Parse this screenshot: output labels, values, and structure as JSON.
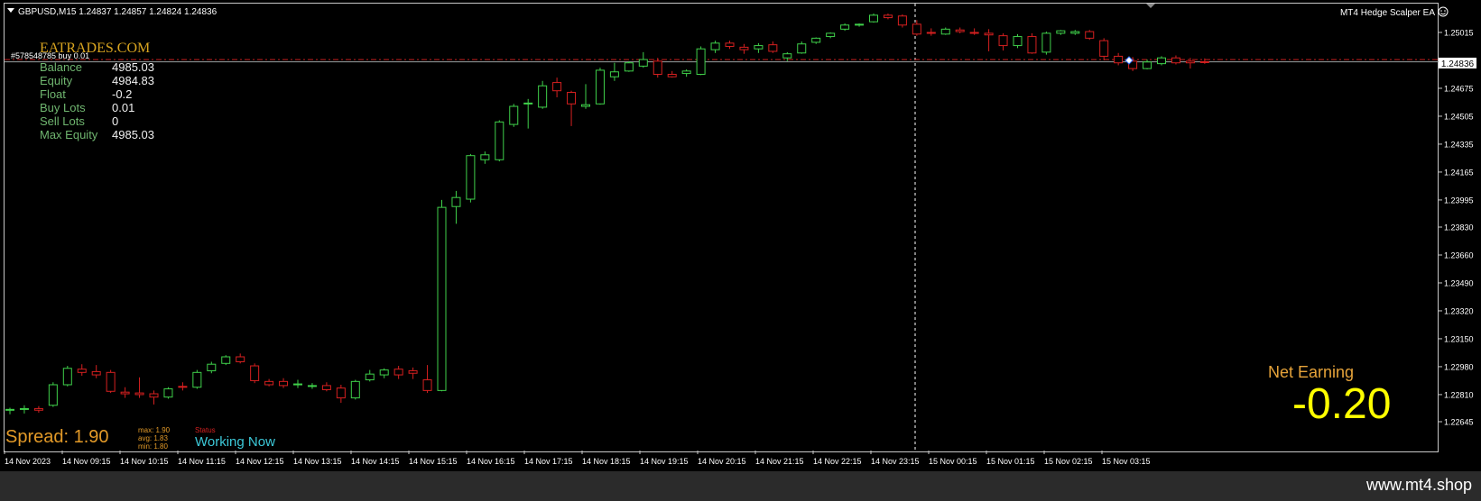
{
  "window": {
    "header_text": "GBPUSD,M15  1.24837 1.24857 1.24824 1.24836",
    "ea_name": "MT4 Hedge Scalper EA",
    "ea_status_icon": "smiley-icon"
  },
  "overlay": {
    "brand": "EATRADES.COM",
    "order_label": "#578548785 buy 0.01",
    "stats": [
      {
        "label": "Balance",
        "value": "4985.03"
      },
      {
        "label": "Equity",
        "value": "4984.83"
      },
      {
        "label": "Float",
        "value": "-0.2"
      },
      {
        "label": "Buy Lots",
        "value": "0.01"
      },
      {
        "label": "Sell Lots",
        "value": "0"
      },
      {
        "label": "Max Equity",
        "value": "4985.03"
      }
    ],
    "spread_text": "Spread: 1.90",
    "spread_max": "max: 1.90",
    "spread_avg": "avg: 1.83",
    "spread_min": "min: 1.80",
    "status_label": "Status",
    "status_text": "Working Now",
    "net_earning_label": "Net Earning",
    "net_earning_value": "-0.20"
  },
  "footer": {
    "site": "www.mt4.shop"
  },
  "colors": {
    "bull": "#3fd04a",
    "bear": "#d62020",
    "grid_text": "#ffffff",
    "bid_line": "#9aa0a0",
    "order_line": "#c81e1e",
    "brand": "#d9a520",
    "net_label": "#e6a33a",
    "net_value": "#ffff00",
    "status": "#3cc8d8",
    "spread": "#e39a28"
  },
  "chart_data": {
    "type": "candlestick",
    "symbol": "GBPUSD",
    "timeframe": "M15",
    "current_price": "1.24836",
    "ylim": [
      1.2249,
      1.2527
    ],
    "price_ticks": [
      "1.25015",
      "1.24836",
      "1.24675",
      "1.24505",
      "1.24335",
      "1.24165",
      "1.23995",
      "1.23830",
      "1.23660",
      "1.23490",
      "1.23320",
      "1.23150",
      "1.22980",
      "1.22810",
      "1.22645"
    ],
    "time_labels": [
      "14 Nov 2023",
      "14 Nov 09:15",
      "14 Nov 10:15",
      "14 Nov 11:15",
      "14 Nov 12:15",
      "14 Nov 13:15",
      "14 Nov 14:15",
      "14 Nov 15:15",
      "14 Nov 16:15",
      "14 Nov 17:15",
      "14 Nov 18:15",
      "14 Nov 19:15",
      "14 Nov 20:15",
      "14 Nov 21:15",
      "14 Nov 22:15",
      "14 Nov 23:15",
      "15 Nov 00:15",
      "15 Nov 01:15",
      "15 Nov 02:15",
      "15 Nov 03:15"
    ],
    "candles": [
      {
        "o": 1.22715,
        "h": 1.2273,
        "l": 1.2269,
        "c": 1.2272
      },
      {
        "o": 1.2272,
        "h": 1.22745,
        "l": 1.22695,
        "c": 1.22725
      },
      {
        "o": 1.22725,
        "h": 1.2274,
        "l": 1.227,
        "c": 1.22715
      },
      {
        "o": 1.22745,
        "h": 1.22885,
        "l": 1.22735,
        "c": 1.2287
      },
      {
        "o": 1.2287,
        "h": 1.22985,
        "l": 1.2286,
        "c": 1.2297
      },
      {
        "o": 1.22965,
        "h": 1.22995,
        "l": 1.22925,
        "c": 1.22945
      },
      {
        "o": 1.2295,
        "h": 1.2299,
        "l": 1.2291,
        "c": 1.2293
      },
      {
        "o": 1.22945,
        "h": 1.2296,
        "l": 1.2282,
        "c": 1.2283
      },
      {
        "o": 1.22825,
        "h": 1.22855,
        "l": 1.2279,
        "c": 1.22815
      },
      {
        "o": 1.2282,
        "h": 1.22915,
        "l": 1.2279,
        "c": 1.2281
      },
      {
        "o": 1.22815,
        "h": 1.22835,
        "l": 1.2275,
        "c": 1.22795
      },
      {
        "o": 1.22795,
        "h": 1.22855,
        "l": 1.22785,
        "c": 1.22845
      },
      {
        "o": 1.2286,
        "h": 1.22885,
        "l": 1.22835,
        "c": 1.22855
      },
      {
        "o": 1.22855,
        "h": 1.2296,
        "l": 1.22845,
        "c": 1.22945
      },
      {
        "o": 1.22955,
        "h": 1.2301,
        "l": 1.2294,
        "c": 1.22995
      },
      {
        "o": 1.23,
        "h": 1.2305,
        "l": 1.2299,
        "c": 1.2304
      },
      {
        "o": 1.2304,
        "h": 1.2306,
        "l": 1.23,
        "c": 1.2301
      },
      {
        "o": 1.22985,
        "h": 1.23,
        "l": 1.2288,
        "c": 1.22895
      },
      {
        "o": 1.2289,
        "h": 1.22905,
        "l": 1.2286,
        "c": 1.2287
      },
      {
        "o": 1.2289,
        "h": 1.2291,
        "l": 1.2285,
        "c": 1.22865
      },
      {
        "o": 1.2287,
        "h": 1.229,
        "l": 1.2285,
        "c": 1.22875
      },
      {
        "o": 1.2286,
        "h": 1.2288,
        "l": 1.22845,
        "c": 1.22865
      },
      {
        "o": 1.22865,
        "h": 1.22885,
        "l": 1.2283,
        "c": 1.2284
      },
      {
        "o": 1.2285,
        "h": 1.2287,
        "l": 1.2276,
        "c": 1.2279
      },
      {
        "o": 1.2279,
        "h": 1.229,
        "l": 1.2278,
        "c": 1.2289
      },
      {
        "o": 1.229,
        "h": 1.2296,
        "l": 1.2289,
        "c": 1.22935
      },
      {
        "o": 1.2293,
        "h": 1.2297,
        "l": 1.2291,
        "c": 1.2296
      },
      {
        "o": 1.22965,
        "h": 1.22985,
        "l": 1.22905,
        "c": 1.2293
      },
      {
        "o": 1.22955,
        "h": 1.22975,
        "l": 1.22905,
        "c": 1.2294
      },
      {
        "o": 1.229,
        "h": 1.2299,
        "l": 1.2282,
        "c": 1.22835
      },
      {
        "o": 1.22835,
        "h": 1.23995,
        "l": 1.2283,
        "c": 1.2395
      },
      {
        "o": 1.23955,
        "h": 1.2405,
        "l": 1.2385,
        "c": 1.2401
      },
      {
        "o": 1.24,
        "h": 1.24275,
        "l": 1.2398,
        "c": 1.24265
      },
      {
        "o": 1.2424,
        "h": 1.2429,
        "l": 1.24215,
        "c": 1.2427
      },
      {
        "o": 1.2424,
        "h": 1.2448,
        "l": 1.2423,
        "c": 1.2447
      },
      {
        "o": 1.24455,
        "h": 1.2458,
        "l": 1.2444,
        "c": 1.24565
      },
      {
        "o": 1.2458,
        "h": 1.2461,
        "l": 1.2443,
        "c": 1.24585
      },
      {
        "o": 1.2456,
        "h": 1.2472,
        "l": 1.2455,
        "c": 1.2469
      },
      {
        "o": 1.2471,
        "h": 1.2474,
        "l": 1.2462,
        "c": 1.2466
      },
      {
        "o": 1.2465,
        "h": 1.2466,
        "l": 1.24445,
        "c": 1.2458
      },
      {
        "o": 1.24565,
        "h": 1.247,
        "l": 1.2455,
        "c": 1.24575
      },
      {
        "o": 1.2458,
        "h": 1.248,
        "l": 1.24575,
        "c": 1.24785
      },
      {
        "o": 1.24745,
        "h": 1.2483,
        "l": 1.2472,
        "c": 1.24775
      },
      {
        "o": 1.2478,
        "h": 1.2484,
        "l": 1.24775,
        "c": 1.2483
      },
      {
        "o": 1.2481,
        "h": 1.24895,
        "l": 1.248,
        "c": 1.2485
      },
      {
        "o": 1.2484,
        "h": 1.2486,
        "l": 1.2474,
        "c": 1.2476
      },
      {
        "o": 1.2476,
        "h": 1.2478,
        "l": 1.2474,
        "c": 1.24745
      },
      {
        "o": 1.24765,
        "h": 1.2479,
        "l": 1.24745,
        "c": 1.2478
      },
      {
        "o": 1.2476,
        "h": 1.2493,
        "l": 1.24755,
        "c": 1.24915
      },
      {
        "o": 1.2491,
        "h": 1.24965,
        "l": 1.2489,
        "c": 1.2495
      },
      {
        "o": 1.2495,
        "h": 1.24965,
        "l": 1.24915,
        "c": 1.2493
      },
      {
        "o": 1.24925,
        "h": 1.24945,
        "l": 1.24885,
        "c": 1.2491
      },
      {
        "o": 1.24915,
        "h": 1.2495,
        "l": 1.2489,
        "c": 1.24935
      },
      {
        "o": 1.2494,
        "h": 1.2496,
        "l": 1.2489,
        "c": 1.249
      },
      {
        "o": 1.2486,
        "h": 1.24895,
        "l": 1.2484,
        "c": 1.24885
      },
      {
        "o": 1.2489,
        "h": 1.2496,
        "l": 1.24885,
        "c": 1.24945
      },
      {
        "o": 1.24955,
        "h": 1.24985,
        "l": 1.24945,
        "c": 1.2498
      },
      {
        "o": 1.2499,
        "h": 1.25015,
        "l": 1.2498,
        "c": 1.2501
      },
      {
        "o": 1.25035,
        "h": 1.2507,
        "l": 1.25025,
        "c": 1.2506
      },
      {
        "o": 1.2506,
        "h": 1.2507,
        "l": 1.2505,
        "c": 1.25065
      },
      {
        "o": 1.2508,
        "h": 1.2513,
        "l": 1.25075,
        "c": 1.2512
      },
      {
        "o": 1.2512,
        "h": 1.2513,
        "l": 1.25095,
        "c": 1.25105
      },
      {
        "o": 1.25115,
        "h": 1.25125,
        "l": 1.25045,
        "c": 1.2506
      },
      {
        "o": 1.25065,
        "h": 1.2509,
        "l": 1.24995,
        "c": 1.25005
      },
      {
        "o": 1.25015,
        "h": 1.2504,
        "l": 1.24995,
        "c": 1.2501
      },
      {
        "o": 1.25005,
        "h": 1.25045,
        "l": 1.25,
        "c": 1.25035
      },
      {
        "o": 1.2503,
        "h": 1.25045,
        "l": 1.2501,
        "c": 1.2502
      },
      {
        "o": 1.25015,
        "h": 1.2504,
        "l": 1.25,
        "c": 1.2501
      },
      {
        "o": 1.2501,
        "h": 1.25035,
        "l": 1.249,
        "c": 1.25
      },
      {
        "o": 1.24995,
        "h": 1.2501,
        "l": 1.24905,
        "c": 1.24935
      },
      {
        "o": 1.24935,
        "h": 1.25005,
        "l": 1.2492,
        "c": 1.2499
      },
      {
        "o": 1.2499,
        "h": 1.2501,
        "l": 1.24885,
        "c": 1.2489
      },
      {
        "o": 1.24895,
        "h": 1.2502,
        "l": 1.2488,
        "c": 1.2501
      },
      {
        "o": 1.2501,
        "h": 1.2503,
        "l": 1.25,
        "c": 1.25025
      },
      {
        "o": 1.2501,
        "h": 1.2503,
        "l": 1.25,
        "c": 1.2502
      },
      {
        "o": 1.2502,
        "h": 1.2503,
        "l": 1.2497,
        "c": 1.2498
      },
      {
        "o": 1.24965,
        "h": 1.2498,
        "l": 1.24845,
        "c": 1.2487
      },
      {
        "o": 1.2487,
        "h": 1.2489,
        "l": 1.24815,
        "c": 1.2483
      },
      {
        "o": 1.2484,
        "h": 1.24865,
        "l": 1.2478,
        "c": 1.24795
      },
      {
        "o": 1.24795,
        "h": 1.2485,
        "l": 1.2479,
        "c": 1.24835
      },
      {
        "o": 1.24825,
        "h": 1.2487,
        "l": 1.24815,
        "c": 1.2486
      },
      {
        "o": 1.2486,
        "h": 1.24875,
        "l": 1.2482,
        "c": 1.2483
      },
      {
        "o": 1.2484,
        "h": 1.2486,
        "l": 1.24795,
        "c": 1.2483
      },
      {
        "o": 1.24837,
        "h": 1.24857,
        "l": 1.24824,
        "c": 1.24836
      }
    ]
  }
}
